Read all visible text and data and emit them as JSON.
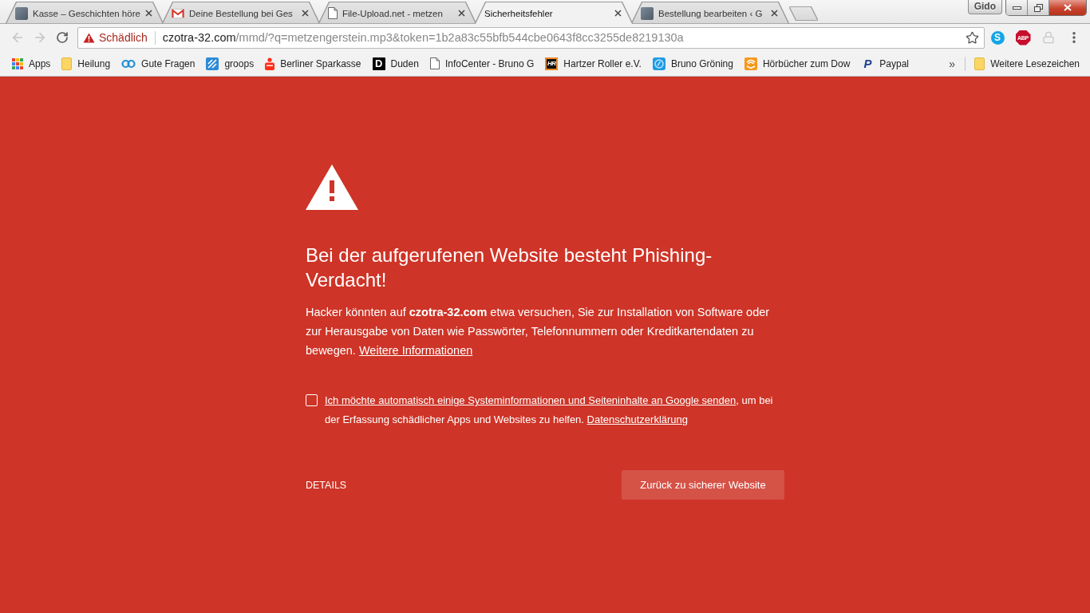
{
  "tabs": [
    {
      "title": "Kasse – Geschichten höre",
      "kind": "photo",
      "selected": false
    },
    {
      "title": "Deine Bestellung bei Ges",
      "kind": "mail",
      "selected": false
    },
    {
      "title": "File-Upload.net - metzen",
      "kind": "page",
      "selected": false
    },
    {
      "title": "Sicherheitsfehler",
      "kind": "none",
      "selected": true
    },
    {
      "title": "Bestellung bearbeiten ‹ G",
      "kind": "photo",
      "selected": false
    }
  ],
  "profile": "Gido",
  "toolbar": {
    "nav": [
      {
        "kind": "back",
        "disabled": true
      },
      {
        "kind": "forward",
        "disabled": true
      },
      {
        "kind": "reload",
        "disabled": false
      }
    ],
    "omnibox": {
      "security_label": "Schädlich",
      "host": "czotra-32.com",
      "path": "/mmd/?q=metzengerstein.mp3&token=1b2a83c55bfb544cbe0643f8cc3255de8219130a"
    },
    "extensions": [
      {
        "kind": "round",
        "icon_text": "S"
      },
      {
        "kind": "octagon",
        "icon_text": "ABP"
      },
      {
        "kind": "lock"
      }
    ]
  },
  "bookmarks": {
    "items": [
      {
        "label": "Apps",
        "kind": "apps"
      },
      {
        "label": "Heilung",
        "kind": "folder"
      },
      {
        "label": "Gute Fragen",
        "kind": "rings"
      },
      {
        "label": "groops",
        "kind": "tile"
      },
      {
        "label": "Berliner Sparkasse",
        "kind": "bank"
      },
      {
        "label": "Duden",
        "kind": "monogram",
        "icon_text": "D"
      },
      {
        "label": "InfoCenter - Bruno G",
        "kind": "page"
      },
      {
        "label": "Hartzer Roller e.V.",
        "kind": "badge",
        "icon_text": "HR"
      },
      {
        "label": "Bruno Gröning",
        "kind": "emblem"
      },
      {
        "label": "Hörbücher zum Dow",
        "kind": "waves"
      },
      {
        "label": "Paypal",
        "kind": "script",
        "icon_text": "P"
      }
    ],
    "overflow": "»",
    "other": {
      "label": "Weitere Lesezeichen",
      "kind": "folder"
    }
  },
  "interstitial": {
    "heading": "Bei der aufgerufenen Website besteht Phishing-Verdacht!",
    "message": "Hacker könnten auf **czotra-32.com** etwa versuchen, Sie zur Installation von Software oder zur Herausgabe von Daten wie Passwörter, Telefonnummern oder Kreditkartendaten zu bewegen.",
    "more_info_link": "Weitere Informationen",
    "report": {
      "checked": false,
      "link": "Ich möchte automatisch einige Systeminformationen und Seiteninhalte an Google senden",
      "text": ", um bei der Erfassung schädlicher Apps und Websites zu helfen.",
      "privacy_link": "Datenschutzerklärung"
    },
    "details_button": "DETAILS",
    "back_button": "Zurück zu sicherer Website"
  }
}
